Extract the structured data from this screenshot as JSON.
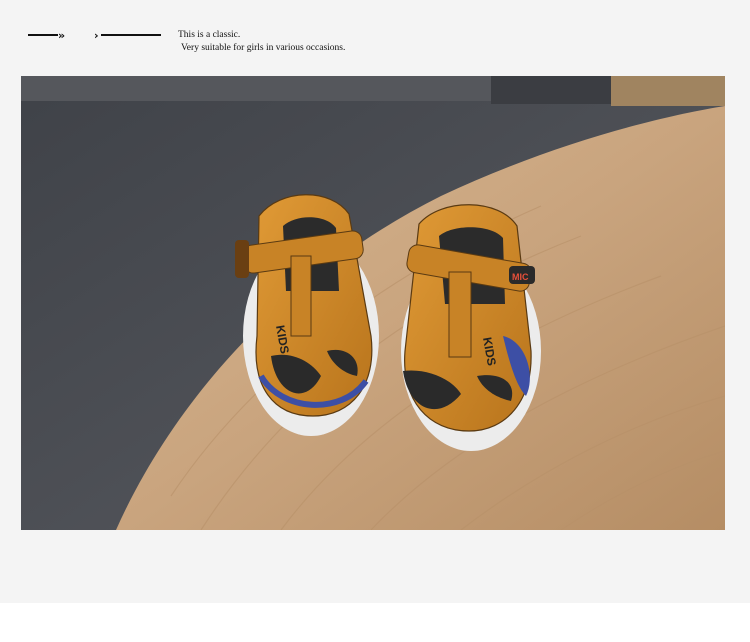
{
  "header": {
    "left_arrow": "»",
    "right_arrow": "›",
    "caption_line1": "This is a classic.",
    "caption_line2": "Very suitable for girls in various occasions."
  },
  "photo": {
    "alt": "kids sandals on wooden table",
    "sandal_left_text": "KIDS",
    "sandal_right_text": "KIDS",
    "badge_text": "MIC"
  },
  "colors": {
    "page_bg": "#f4f4f4",
    "sofa": "#4a4c52",
    "wood": "#c9a47e",
    "sandal": "#d18a2a"
  }
}
